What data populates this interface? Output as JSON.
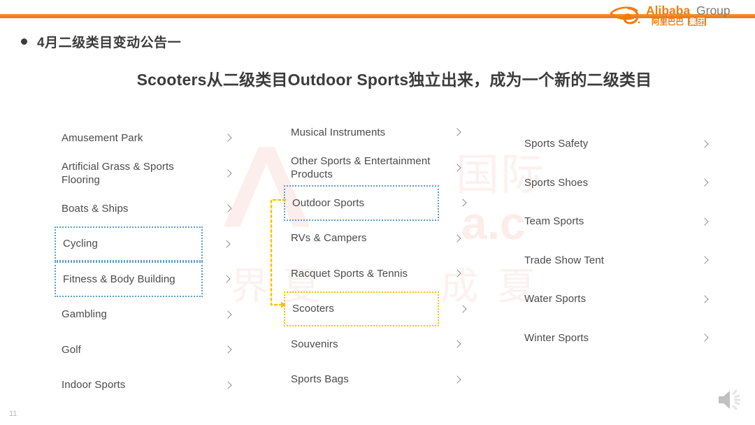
{
  "slide": {
    "page_number": "11",
    "accent_bar_color": "#ee7d15",
    "highlight_blue": "#5b9bd5",
    "highlight_orange": "#ffc000"
  },
  "logo": {
    "name": "alibaba-group-logo",
    "wordmark": "Alibaba",
    "suffix": "Group",
    "chinese": "阿里巴巴集团"
  },
  "heading": {
    "bullet_text": "4月二级类目变动公告一"
  },
  "subtitle": {
    "text": "Scooters从二级类目Outdoor Sports独立出来，成为一个新的二级类目"
  },
  "watermark": {
    "logo_glyph": "ᐱ",
    "cn_top": "国际",
    "latin": "a.c",
    "cn_bottom_left": "界夏",
    "cn_bottom_right": "成夏"
  },
  "columns": [
    {
      "name": "category-column-1",
      "items": [
        {
          "label": "Amusement Park",
          "highlight": "none"
        },
        {
          "label": "Artificial Grass & Sports Flooring",
          "highlight": "none"
        },
        {
          "label": "Boats & Ships",
          "highlight": "none"
        },
        {
          "label": "Cycling",
          "highlight": "blue"
        },
        {
          "label": "Fitness & Body Building",
          "highlight": "blue"
        },
        {
          "label": "Gambling",
          "highlight": "none"
        },
        {
          "label": "Golf",
          "highlight": "none"
        },
        {
          "label": "Indoor Sports",
          "highlight": "none"
        }
      ]
    },
    {
      "name": "category-column-2",
      "items": [
        {
          "label": "Musical Instruments",
          "highlight": "none"
        },
        {
          "label": "Other Sports & Entertainment Products",
          "highlight": "none"
        },
        {
          "label": "Outdoor Sports",
          "highlight": "blue"
        },
        {
          "label": "RVs & Campers",
          "highlight": "none"
        },
        {
          "label": "Racquet Sports & Tennis",
          "highlight": "none"
        },
        {
          "label": "Scooters",
          "highlight": "orange"
        },
        {
          "label": "Souvenirs",
          "highlight": "none"
        },
        {
          "label": "Sports Bags",
          "highlight": "none"
        }
      ]
    },
    {
      "name": "category-column-3",
      "items": [
        {
          "label": "Sports Safety",
          "highlight": "none"
        },
        {
          "label": "Sports Shoes",
          "highlight": "none"
        },
        {
          "label": "Team Sports",
          "highlight": "none"
        },
        {
          "label": "Trade Show Tent",
          "highlight": "none"
        },
        {
          "label": "Water Sports",
          "highlight": "none"
        },
        {
          "label": "Winter Sports",
          "highlight": "none"
        }
      ]
    }
  ],
  "connector": {
    "name": "outdoor-sports-to-scooters-arrow",
    "from": "Outdoor Sports",
    "to": "Scooters",
    "color": "#ffc000"
  },
  "speaker": {
    "name": "speaker-icon",
    "state": "on"
  }
}
